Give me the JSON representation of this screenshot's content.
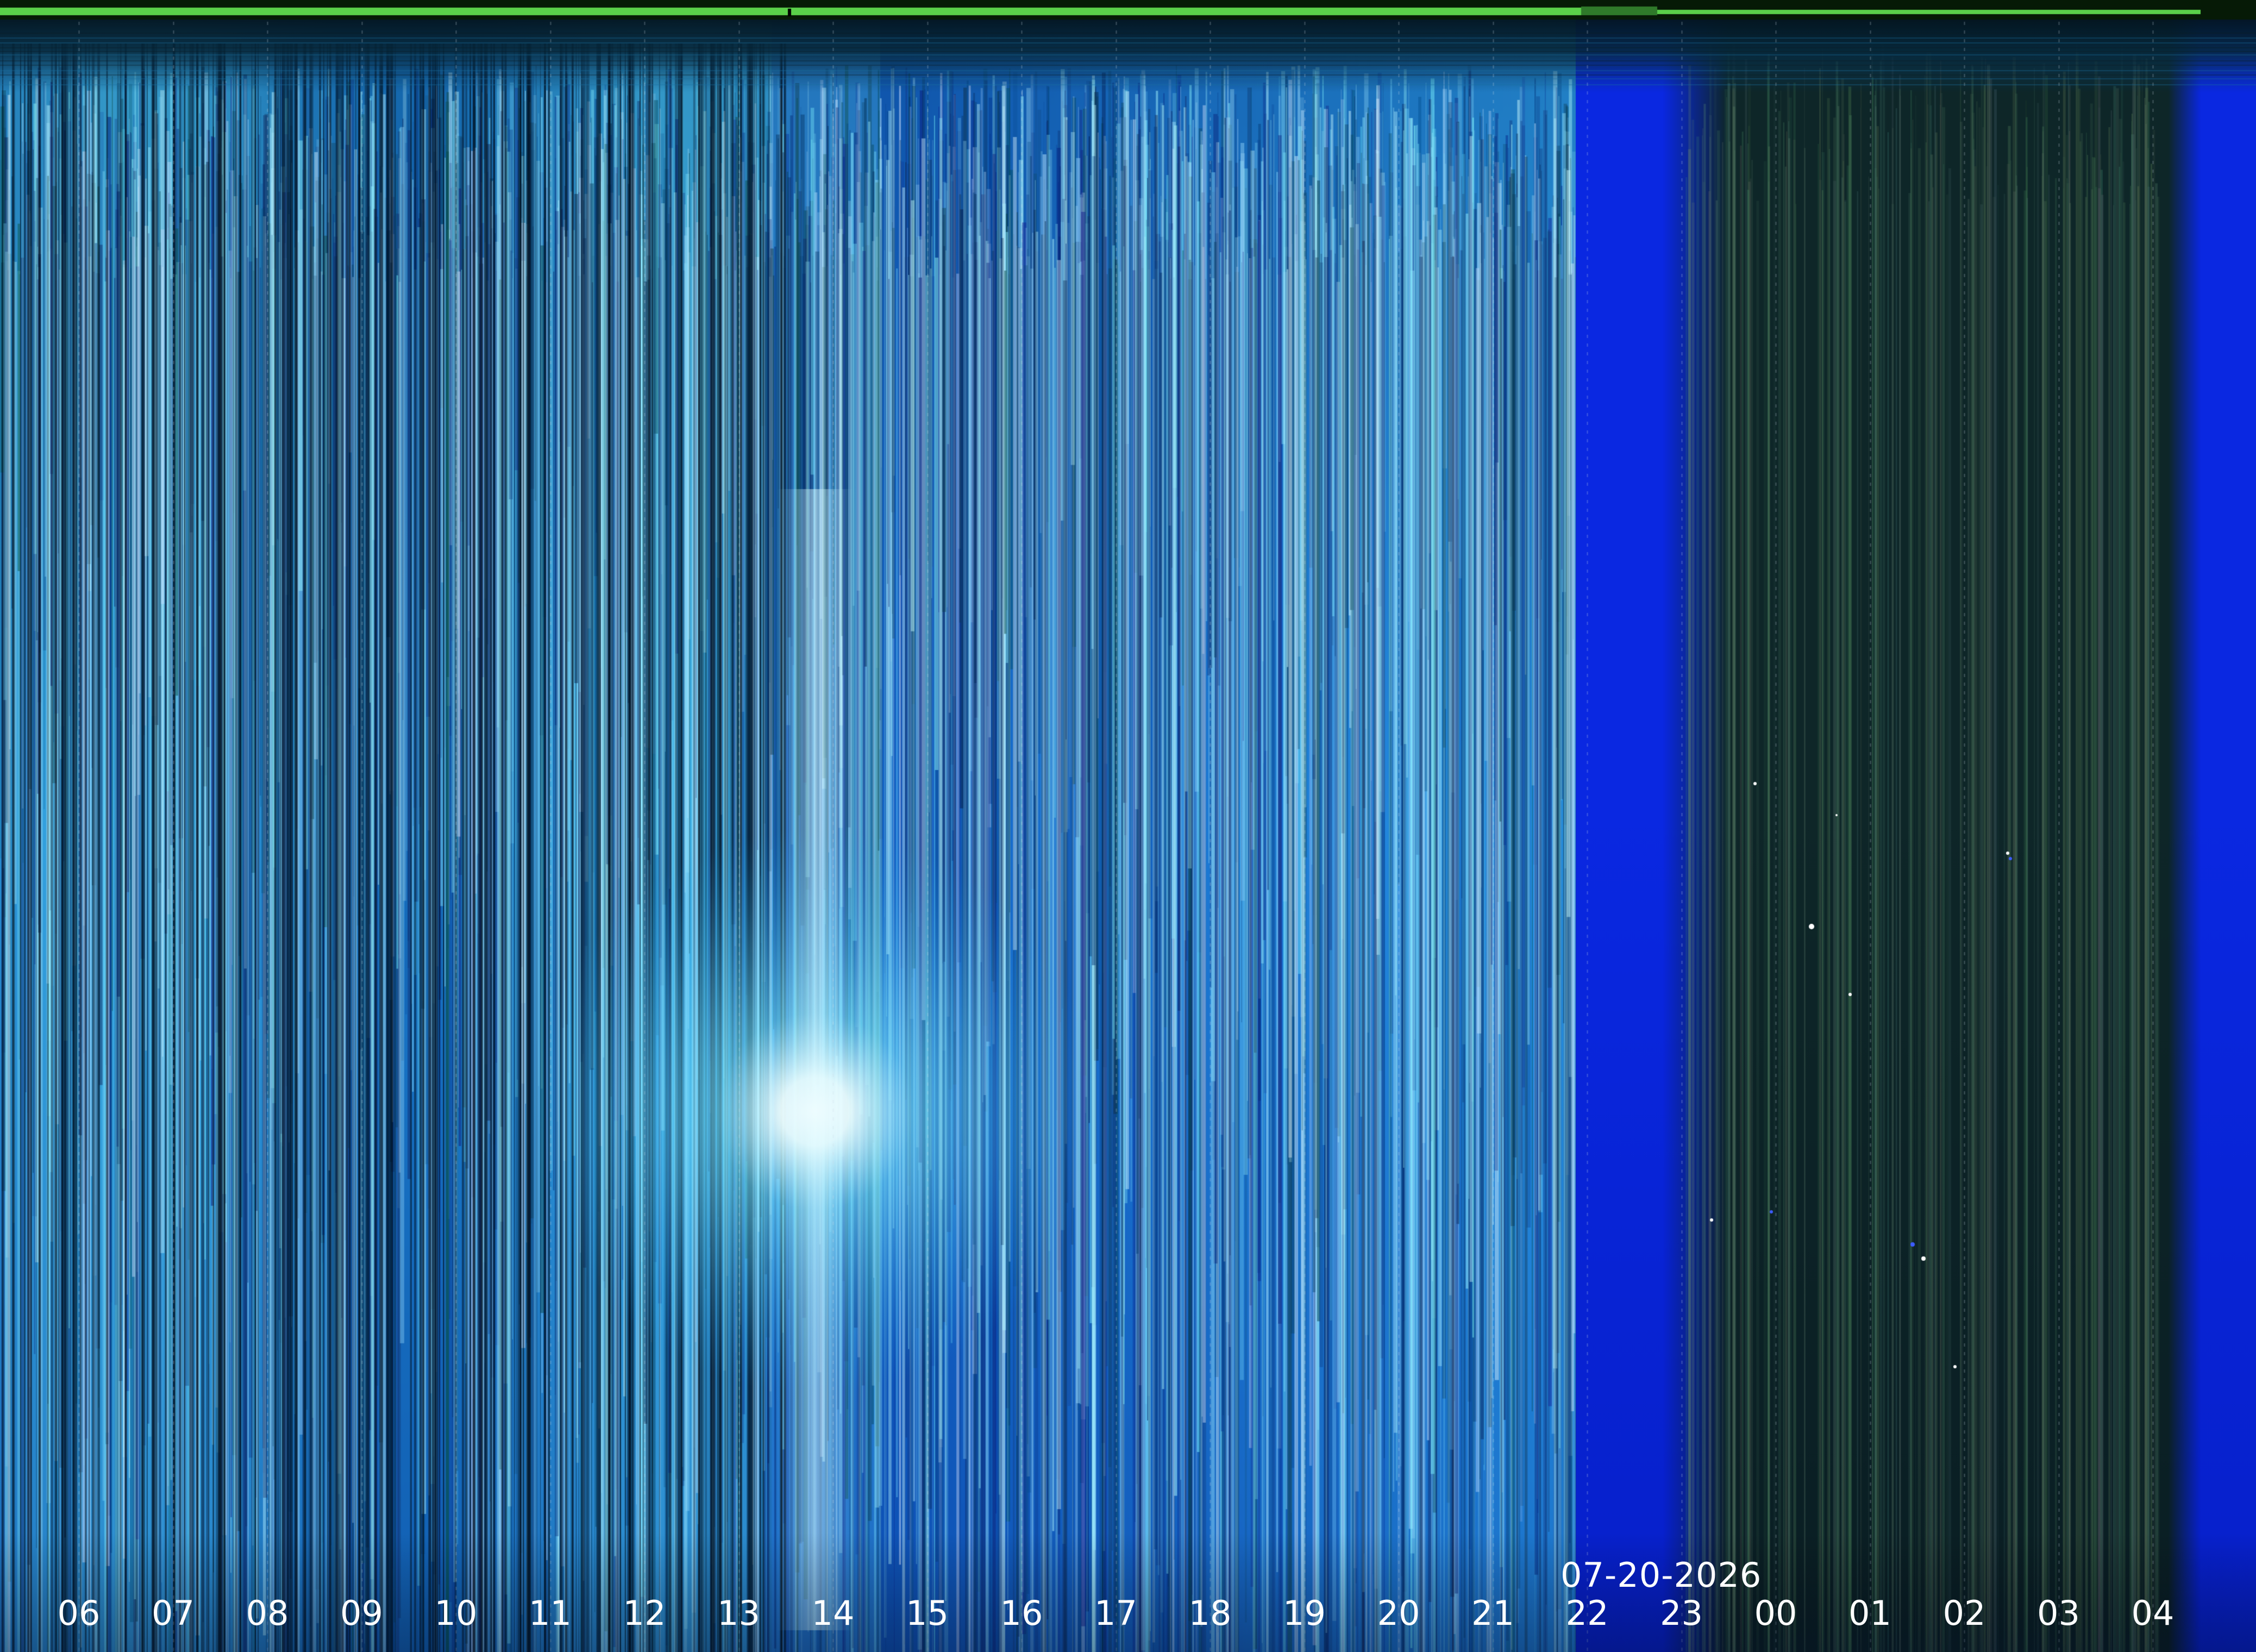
{
  "keogram": {
    "date": "07-20-2026",
    "hour_labels": [
      "06",
      "07",
      "08",
      "09",
      "10",
      "11",
      "12",
      "13",
      "14",
      "15",
      "16",
      "17",
      "18",
      "19",
      "20",
      "21",
      "22",
      "23",
      "00",
      "01",
      "02",
      "03",
      "04"
    ],
    "colors": {
      "day_sky": "#1f86d6",
      "day_sky_light": "#45b8ee",
      "night_sky": "#0f2a2d",
      "twilight": "#0a3de6",
      "status_bar": "#5ad04a",
      "sun": "#ffffff"
    },
    "icons": {
      "sun": "sun-glare-icon"
    }
  }
}
